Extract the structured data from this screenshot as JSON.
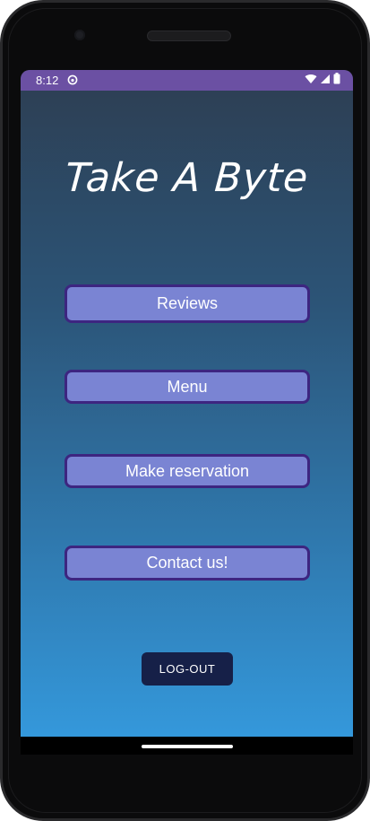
{
  "status_bar": {
    "time": "8:12",
    "app_icon": "circle-face-icon",
    "icons": [
      "wifi-icon",
      "cell-signal-icon",
      "battery-icon"
    ],
    "background": "#6b50a3"
  },
  "app": {
    "title": "Take A Byte"
  },
  "buttons": {
    "reviews": "Reviews",
    "menu": "Menu",
    "reservation": "Make reservation",
    "contact": "Contact us!",
    "logout": "LOG-OUT"
  },
  "colors": {
    "button_fill": "#7a84d3",
    "button_border": "#3d2580",
    "logout_fill": "#162048",
    "gradient_top": "#2d3e52",
    "gradient_bottom": "#3498db"
  }
}
